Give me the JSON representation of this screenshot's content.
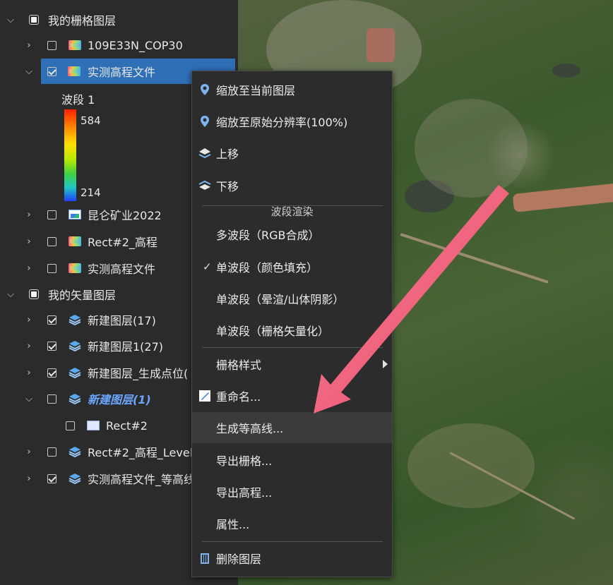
{
  "raster_group": {
    "label": "我的栅格图层"
  },
  "raster_layers": [
    {
      "label": "109E33N_COP30"
    },
    {
      "label": "实测高程文件"
    }
  ],
  "legend": {
    "band_label": "波段 1",
    "max": "584",
    "min": "214"
  },
  "raster_layers_2": [
    {
      "label": "昆仑矿业2022"
    },
    {
      "label": "Rect#2_高程"
    },
    {
      "label": "实测高程文件"
    }
  ],
  "vector_group": {
    "label": "我的矢量图层"
  },
  "vector_layers": [
    {
      "label": "新建图层(17)"
    },
    {
      "label": "新建图层1(27)"
    },
    {
      "label": "新建图层_生成点位("
    },
    {
      "label": "新建图层(1)"
    },
    {
      "label": "Rect#2"
    },
    {
      "label": "Rect#2_高程_Level_"
    },
    {
      "label": "实测高程文件_等高线"
    }
  ],
  "menu": {
    "zoom_layer": "缩放至当前图层",
    "zoom_native": "缩放至原始分辨率(100%)",
    "move_up": "上移",
    "move_down": "下移",
    "band_render_header": "波段渲染",
    "multi_band": "多波段（RGB合成）",
    "single_band_fill": "单波段（颜色填充）",
    "single_band_hillshade": "单波段（晕渲/山体阴影）",
    "single_band_vectorize": "单波段（栅格矢量化）",
    "raster_style": "栅格样式",
    "rename": "重命名...",
    "contour": "生成等高线...",
    "export_raster": "导出栅格...",
    "export_elevation": "导出高程...",
    "properties": "属性...",
    "delete_layer": "删除图层"
  },
  "colors": {
    "selection": "#2f6fb6",
    "accent_arrow": "#f0506e",
    "italic_layer": "#6aa6ff"
  }
}
